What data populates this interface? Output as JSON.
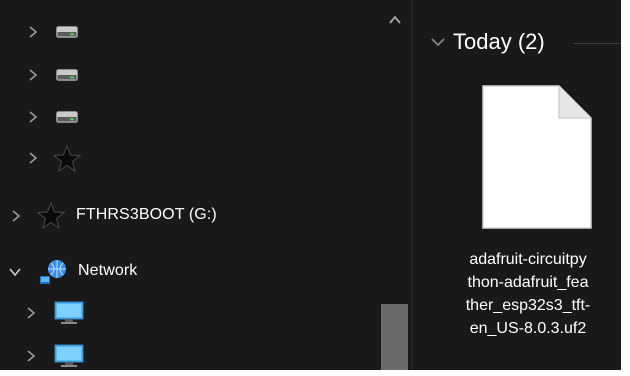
{
  "navigation_pane": {
    "items": [
      {
        "label": "",
        "icon": "drive-icon"
      },
      {
        "label": "",
        "icon": "drive-icon"
      },
      {
        "label": "",
        "icon": "drive-icon"
      },
      {
        "label": "",
        "icon": "star-drive-icon"
      },
      {
        "label": "FTHRS3BOOT (G:)",
        "icon": "star-drive-icon"
      },
      {
        "label": "Network",
        "icon": "network-icon",
        "expanded": true
      },
      {
        "label": "",
        "icon": "computer-icon"
      },
      {
        "label": "",
        "icon": "computer-icon"
      }
    ]
  },
  "content": {
    "group": {
      "title": "Today (2)"
    },
    "file": {
      "name_lines": [
        "adafruit-circuitpy",
        "thon-adafruit_fea",
        "ther_esp32s3_tft-",
        "en_US-8.0.3.uf2"
      ],
      "icon": "blank-file-icon"
    }
  },
  "colors": {
    "background": "#191919",
    "text": "#ffffff",
    "chevron": "#9a9a9a",
    "scrollbar_thumb": "#6b6b6b",
    "network_blue": "#3a8fe8"
  }
}
